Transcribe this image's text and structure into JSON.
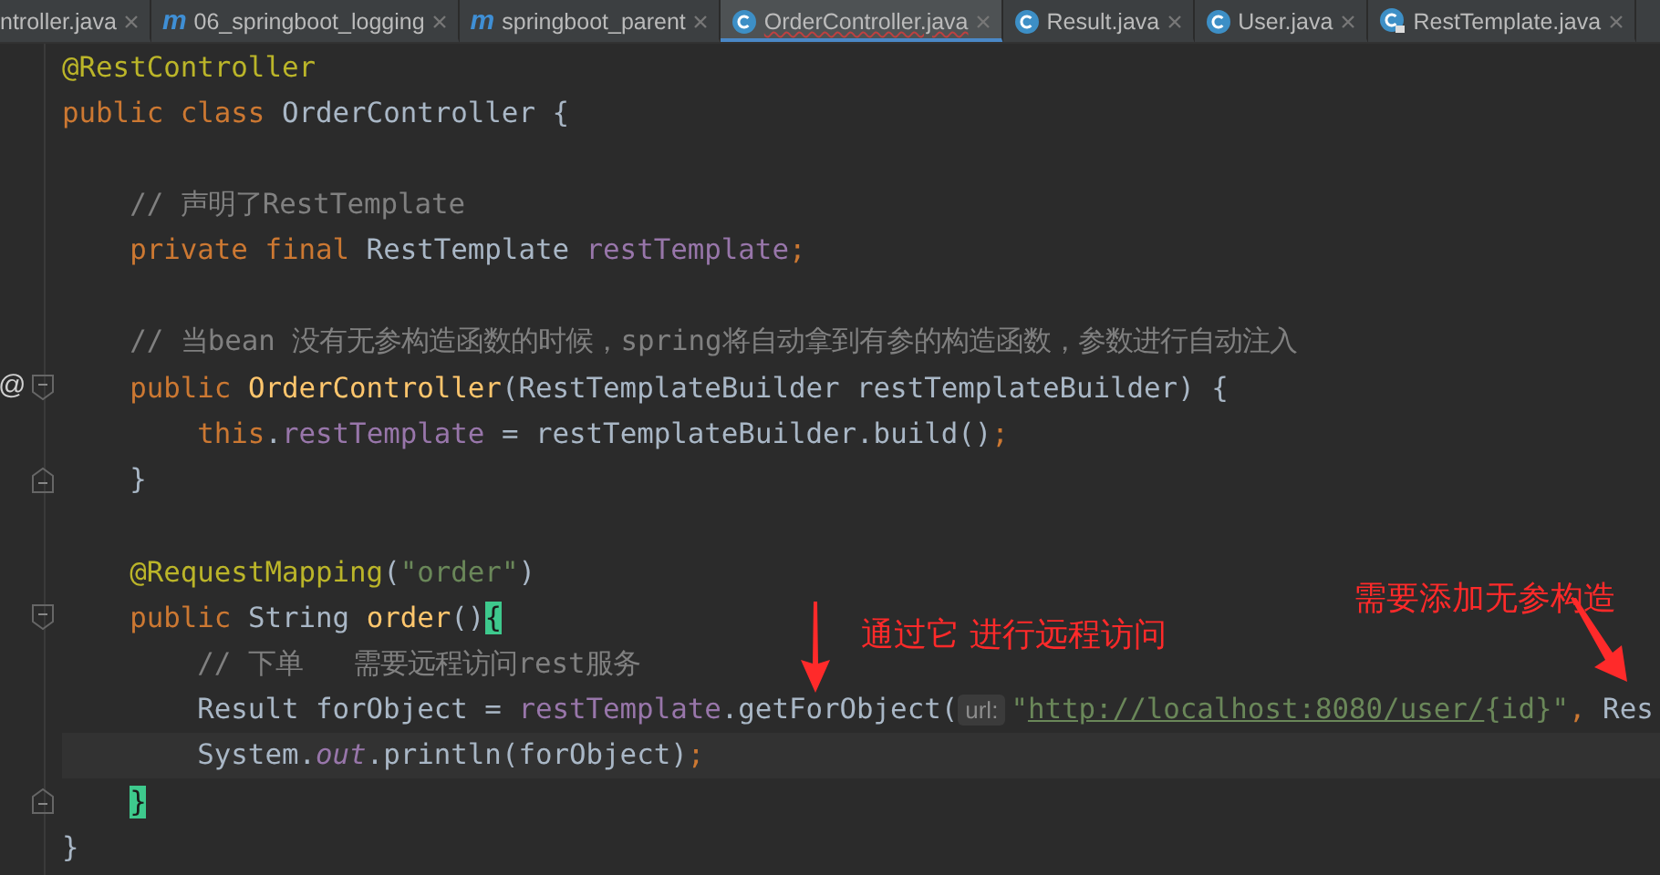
{
  "tabs": [
    {
      "label": "ntroller.java",
      "kind": "plain",
      "selected": false
    },
    {
      "label": "06_springboot_logging",
      "kind": "module",
      "icon_text": "m",
      "selected": false
    },
    {
      "label": "springboot_parent",
      "kind": "module",
      "icon_text": "m",
      "selected": false
    },
    {
      "label": "OrderController.java",
      "kind": "class",
      "selected": true
    },
    {
      "label": "Result.java",
      "kind": "class",
      "selected": false
    },
    {
      "label": "User.java",
      "kind": "class",
      "selected": false
    },
    {
      "label": "RestTemplate.java",
      "kind": "locked-class",
      "selected": false
    }
  ],
  "editor": {
    "lines": [
      {
        "kind": "code",
        "tokens": [
          {
            "kind": "annotation",
            "text": "@RestController"
          }
        ]
      },
      {
        "kind": "code",
        "tokens": [
          {
            "kind": "keyword",
            "text": "public class "
          },
          {
            "kind": "plain",
            "text": "OrderController {"
          }
        ]
      },
      {
        "kind": "blank"
      },
      {
        "kind": "code",
        "tokens": [
          {
            "kind": "comment",
            "text": "    // 声明了RestTemplate"
          }
        ]
      },
      {
        "kind": "code",
        "tokens": [
          {
            "kind": "keyword",
            "text": "    private final "
          },
          {
            "kind": "plain",
            "text": "RestTemplate "
          },
          {
            "kind": "field",
            "text": "restTemplate"
          },
          {
            "kind": "keyword",
            "text": ";"
          }
        ]
      },
      {
        "kind": "blank"
      },
      {
        "kind": "code",
        "tokens": [
          {
            "kind": "comment",
            "text": "    // 当bean 没有无参构造函数的时候，spring将自动拿到有参的构造函数，参数进行自动注入"
          }
        ]
      },
      {
        "kind": "code",
        "gutter_text": "@",
        "fold_start": true,
        "tokens": [
          {
            "kind": "keyword",
            "text": "    public "
          },
          {
            "kind": "method",
            "text": "OrderController"
          },
          {
            "kind": "plain",
            "text": "(RestTemplateBuilder restTemplateBuilder) {"
          }
        ]
      },
      {
        "kind": "code",
        "tokens": [
          {
            "kind": "keyword",
            "text": "        this"
          },
          {
            "kind": "plain",
            "text": "."
          },
          {
            "kind": "field",
            "text": "restTemplate"
          },
          {
            "kind": "plain",
            "text": " = restTemplateBuilder.build()"
          },
          {
            "kind": "keyword",
            "text": ";"
          }
        ]
      },
      {
        "kind": "code",
        "fold_end": true,
        "tokens": [
          {
            "kind": "plain",
            "text": "    }"
          }
        ]
      },
      {
        "kind": "blank"
      },
      {
        "kind": "code",
        "tokens": [
          {
            "kind": "annotation",
            "text": "    @RequestMapping"
          },
          {
            "kind": "plain",
            "text": "("
          },
          {
            "kind": "string",
            "text": "\"order\""
          },
          {
            "kind": "plain",
            "text": ")"
          }
        ]
      },
      {
        "kind": "code",
        "fold_start": true,
        "tokens": [
          {
            "kind": "keyword",
            "text": "    public "
          },
          {
            "kind": "plain",
            "text": "String "
          },
          {
            "kind": "method",
            "text": "order"
          },
          {
            "kind": "plain",
            "text": "()"
          },
          {
            "kind": "brace-match",
            "text": "{"
          }
        ]
      },
      {
        "kind": "code",
        "tokens": [
          {
            "kind": "comment",
            "text": "        // 下单   需要远程访问rest服务"
          }
        ]
      },
      {
        "kind": "code",
        "tokens": [
          {
            "kind": "plain",
            "text": "        Result forObject = "
          },
          {
            "kind": "field",
            "text": "restTemplate"
          },
          {
            "kind": "plain",
            "text": ".getForObject("
          },
          {
            "kind": "hint",
            "text": "url:"
          },
          {
            "kind": "string",
            "text": "\""
          },
          {
            "kind": "url",
            "text": "http://localhost:8080/user/"
          },
          {
            "kind": "string",
            "text": "{id}\""
          },
          {
            "kind": "keyword",
            "text": ", "
          },
          {
            "kind": "plain",
            "text": "Res"
          }
        ]
      },
      {
        "kind": "code",
        "current": true,
        "tokens": [
          {
            "kind": "plain",
            "text": "        System."
          },
          {
            "kind": "static",
            "text": "out"
          },
          {
            "kind": "plain",
            "text": ".println(forObject)"
          },
          {
            "kind": "keyword",
            "text": ";"
          }
        ]
      },
      {
        "kind": "code",
        "fold_end": true,
        "tokens": [
          {
            "kind": "brace-match",
            "text": "    }"
          }
        ]
      },
      {
        "kind": "code",
        "tokens": [
          {
            "kind": "plain",
            "text": "}"
          }
        ]
      }
    ]
  },
  "callouts": [
    {
      "text": "通过它 进行远程访问",
      "kind": "arrow-down"
    },
    {
      "text": "需要添加无参构造",
      "kind": "arrow-down-right"
    }
  ]
}
